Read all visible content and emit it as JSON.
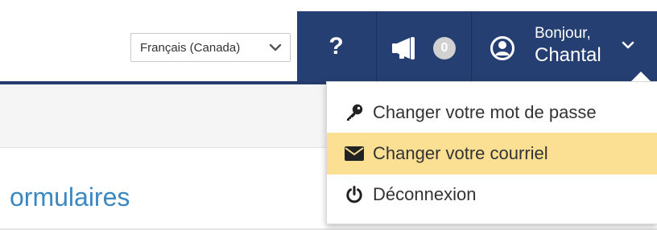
{
  "language_select": {
    "value": "Français (Canada)"
  },
  "nav": {
    "help_label": "?",
    "announcements_count": "0",
    "greeting_line1": "Bonjour,",
    "greeting_line2": "Chantal"
  },
  "page": {
    "title": "ormulaires"
  },
  "user_menu": {
    "items": [
      {
        "label": "Changer votre mot de passe",
        "icon": "key-icon",
        "highlighted": false
      },
      {
        "label": "Changer votre courriel",
        "icon": "envelope-icon",
        "highlighted": true
      },
      {
        "label": "Déconnexion",
        "icon": "power-icon",
        "highlighted": false
      }
    ]
  },
  "colors": {
    "navbar": "#263f72",
    "highlight": "#fbe094",
    "title": "#3a87c2"
  }
}
